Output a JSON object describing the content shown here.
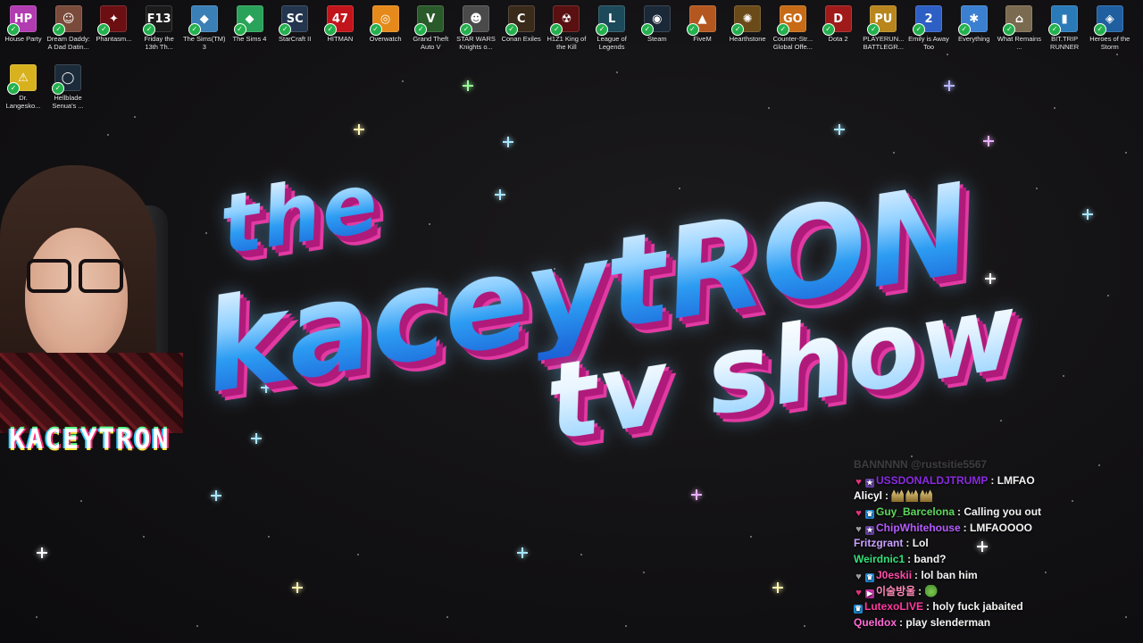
{
  "desktop": {
    "icons": [
      {
        "label": "House Party",
        "glyph": "HP",
        "color": "#b13bb0"
      },
      {
        "label": "Dream Daddy: A Dad Datin...",
        "glyph": "☺",
        "color": "#7a4a3a"
      },
      {
        "label": "Phantasm...",
        "glyph": "✦",
        "color": "#6b0f12"
      },
      {
        "label": "Friday the 13th Th...",
        "glyph": "F13",
        "color": "#1b1b1b"
      },
      {
        "label": "The Sims(TM) 3",
        "glyph": "◆",
        "color": "#3a7fb6"
      },
      {
        "label": "The Sims 4",
        "glyph": "◆",
        "color": "#2aa35a"
      },
      {
        "label": "StarCraft II",
        "glyph": "SC",
        "color": "#23354f"
      },
      {
        "label": "HITMAN",
        "glyph": "47",
        "color": "#c2141b"
      },
      {
        "label": "Overwatch",
        "glyph": "◎",
        "color": "#e58a1a"
      },
      {
        "label": "Grand Theft Auto V",
        "glyph": "V",
        "color": "#2a5a2a"
      },
      {
        "label": "STAR WARS Knights o...",
        "glyph": "☻",
        "color": "#4a4a4a"
      },
      {
        "label": "Conan Exiles",
        "glyph": "C",
        "color": "#3a2a1a"
      },
      {
        "label": "H1Z1 King of the Kill",
        "glyph": "☢",
        "color": "#5a1010"
      },
      {
        "label": "League of Legends",
        "glyph": "L",
        "color": "#1d4a5a"
      },
      {
        "label": "Steam",
        "glyph": "◉",
        "color": "#1b2838"
      },
      {
        "label": "FiveM",
        "glyph": "▲",
        "color": "#b4571f"
      },
      {
        "label": "Hearthstone",
        "glyph": "✺",
        "color": "#6b4a1a"
      },
      {
        "label": "Counter-Str... Global Offe...",
        "glyph": "GO",
        "color": "#c76b16"
      },
      {
        "label": "Dota 2",
        "glyph": "D",
        "color": "#a01a1a"
      },
      {
        "label": "PLAYERUN... BATTLEGR...",
        "glyph": "PU",
        "color": "#b8861d"
      },
      {
        "label": "Emily is Away Too",
        "glyph": "2",
        "color": "#2d5fc4"
      },
      {
        "label": "Everything",
        "glyph": "✱",
        "color": "#3a7fd0"
      },
      {
        "label": "What Remains ...",
        "glyph": "⌂",
        "color": "#7a6a50"
      },
      {
        "label": "BIT.TRIP RUNNER",
        "glyph": "▮",
        "color": "#2a7ab8"
      },
      {
        "label": "Heroes of the Storm",
        "glyph": "◈",
        "color": "#1f5fa0"
      },
      {
        "label": "Dr. Langesko...",
        "glyph": "⚠",
        "color": "#d8b11f"
      },
      {
        "label": "Hellblade Senua's ...",
        "glyph": "◯",
        "color": "#1c2b3a"
      }
    ]
  },
  "logo": {
    "line1": "the",
    "line2": "kaceytRON",
    "line3": "tv show"
  },
  "webcam": {
    "name": "KACEYTRON"
  },
  "chat": {
    "messages": [
      {
        "user": "",
        "text": "BANNNNN @rustsitie5567",
        "color": "#8a8a8a",
        "faded": true,
        "badges": [],
        "emotes": 0
      },
      {
        "user": "USSDONALDJTRUMP",
        "text": "LMFAO",
        "color": "#8a2be2",
        "faded": false,
        "badges": [
          "heart",
          "sub"
        ],
        "emotes": 0
      },
      {
        "user": "Alicyl",
        "text": "",
        "color": "#ffffff",
        "faded": false,
        "badges": [],
        "emotes": 3
      },
      {
        "user": "Guy_Barcelona",
        "text": "Calling you out",
        "color": "#5cd85c",
        "faded": false,
        "badges": [
          "heart",
          "prime"
        ],
        "emotes": 0
      },
      {
        "user": "ChipWhitehouse",
        "text": "LMFAOOOO",
        "color": "#b55cff",
        "faded": false,
        "badges": [
          "heart",
          "sub"
        ],
        "emotes": 0
      },
      {
        "user": "Fritzgrant",
        "text": "Lol",
        "color": "#c9a0ff",
        "faded": false,
        "badges": [],
        "emotes": 0
      },
      {
        "user": "Weirdnic1",
        "text": "band?",
        "color": "#33e07a",
        "faded": false,
        "badges": [],
        "emotes": 0
      },
      {
        "user": "J0eskii",
        "text": "lol ban him",
        "color": "#ff4aa8",
        "faded": false,
        "badges": [
          "heart",
          "prime"
        ],
        "emotes": 0
      },
      {
        "user": "이술방울",
        "text": "",
        "color": "#ff8ab8",
        "faded": false,
        "badges": [
          "heart",
          "turbo"
        ],
        "emotes": 1
      },
      {
        "user": "LutexoLIVE",
        "text": "holy fuck jabaited",
        "color": "#ff3aa0",
        "faded": false,
        "badges": [
          "prime"
        ],
        "emotes": 0
      },
      {
        "user": "Queldox",
        "text": "play slenderman",
        "color": "#ff6ad5",
        "faded": false,
        "badges": [],
        "emotes": 0
      }
    ]
  },
  "stars": [
    {
      "color": "#9bff9b"
    },
    {
      "color": "#b6b6ff"
    },
    {
      "color": "#fff6b0"
    },
    {
      "color": "#a8e6ff"
    },
    {
      "color": "#a8e6ff"
    },
    {
      "color": "#e8b0ff"
    },
    {
      "color": "#a8e6ff"
    },
    {
      "color": "#ffffff"
    },
    {
      "color": "#a8e6ff"
    },
    {
      "color": "#a8e6ff"
    },
    {
      "color": "#e8b0ff"
    },
    {
      "color": "#a8e6ff"
    },
    {
      "color": "#fff6b0"
    },
    {
      "color": "#a8e6ff"
    },
    {
      "color": "#ffffff"
    },
    {
      "color": "#fff6b0"
    },
    {
      "color": "#ffffff"
    },
    {
      "color": "#a8e6ff"
    }
  ]
}
